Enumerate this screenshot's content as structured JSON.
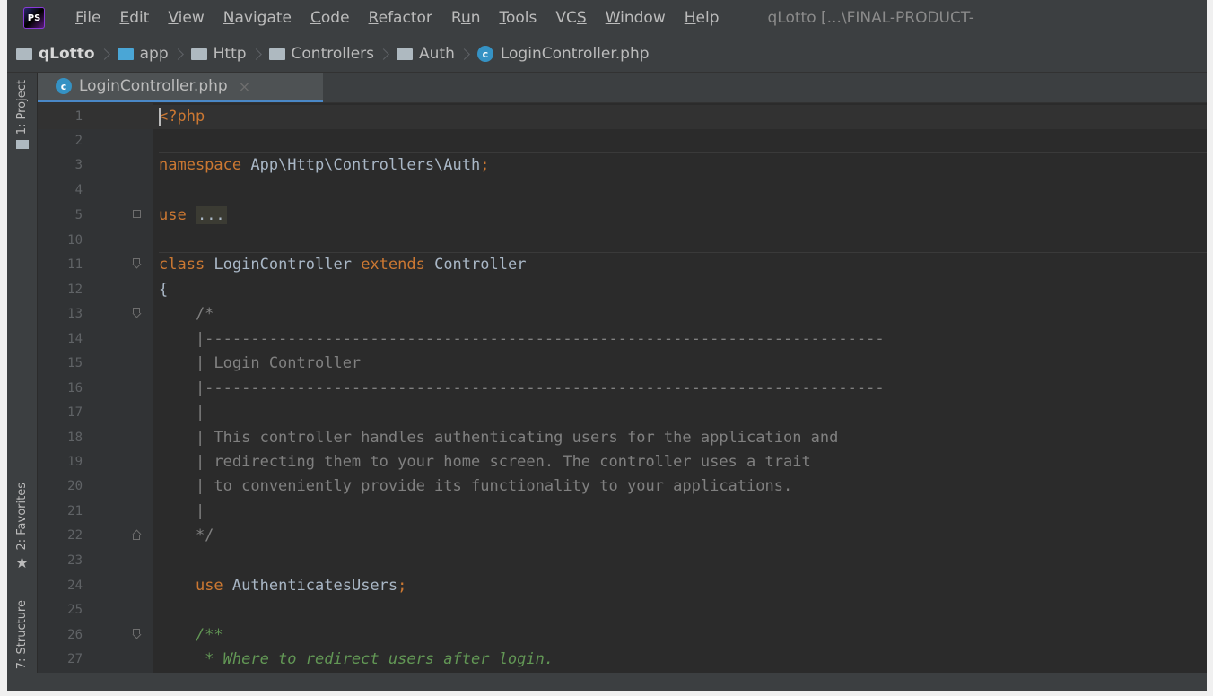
{
  "app": {
    "icon_label": "PS",
    "menu": [
      {
        "pre": "",
        "u": "F",
        "post": "ile"
      },
      {
        "pre": "",
        "u": "E",
        "post": "dit"
      },
      {
        "pre": "",
        "u": "V",
        "post": "iew"
      },
      {
        "pre": "",
        "u": "N",
        "post": "avigate"
      },
      {
        "pre": "",
        "u": "C",
        "post": "ode"
      },
      {
        "pre": "",
        "u": "R",
        "post": "efactor"
      },
      {
        "pre": "R",
        "u": "u",
        "post": "n"
      },
      {
        "pre": "",
        "u": "T",
        "post": "ools"
      },
      {
        "pre": "VC",
        "u": "S",
        "post": ""
      },
      {
        "pre": "",
        "u": "W",
        "post": "indow"
      },
      {
        "pre": "",
        "u": "H",
        "post": "elp"
      }
    ],
    "window_title": "qLotto [...\\FINAL-PRODUCT-"
  },
  "breadcrumb": {
    "items": [
      "qLotto",
      "app",
      "Http",
      "Controllers",
      "Auth",
      "LoginController.php"
    ]
  },
  "toolstrip": {
    "project": "1: Project",
    "favorites": "2: Favorites",
    "structure": "7: Structure"
  },
  "tab": {
    "label": "LoginController.php",
    "close": "×",
    "icon_letter": "c"
  },
  "editor": {
    "lines": [
      {
        "n": "1",
        "text": "<?php"
      },
      {
        "n": "2",
        "text": ""
      },
      {
        "n": "3",
        "text": "namespace App\\Http\\Controllers\\Auth;"
      },
      {
        "n": "4",
        "text": ""
      },
      {
        "n": "5",
        "text": "use ..."
      },
      {
        "n": "10",
        "text": ""
      },
      {
        "n": "11",
        "text": "class LoginController extends Controller"
      },
      {
        "n": "12",
        "text": "{"
      },
      {
        "n": "13",
        "text": "    /*"
      },
      {
        "n": "14",
        "text": "    |--------------------------------------------------------------------------"
      },
      {
        "n": "15",
        "text": "    | Login Controller"
      },
      {
        "n": "16",
        "text": "    |--------------------------------------------------------------------------"
      },
      {
        "n": "17",
        "text": "    |"
      },
      {
        "n": "18",
        "text": "    | This controller handles authenticating users for the application and"
      },
      {
        "n": "19",
        "text": "    | redirecting them to your home screen. The controller uses a trait"
      },
      {
        "n": "20",
        "text": "    | to conveniently provide its functionality to your applications."
      },
      {
        "n": "21",
        "text": "    |"
      },
      {
        "n": "22",
        "text": "    */"
      },
      {
        "n": "23",
        "text": ""
      },
      {
        "n": "24",
        "text": "    use AuthenticatesUsers;"
      },
      {
        "n": "25",
        "text": ""
      },
      {
        "n": "26",
        "text": "    /**"
      },
      {
        "n": "27",
        "text": "     * Where to redirect users after login."
      }
    ]
  },
  "colors": {
    "keyword": "#cc7832",
    "comment": "#808080",
    "doc_comment": "#629755",
    "text": "#a9b7c6",
    "accent": "#4a88c7"
  }
}
